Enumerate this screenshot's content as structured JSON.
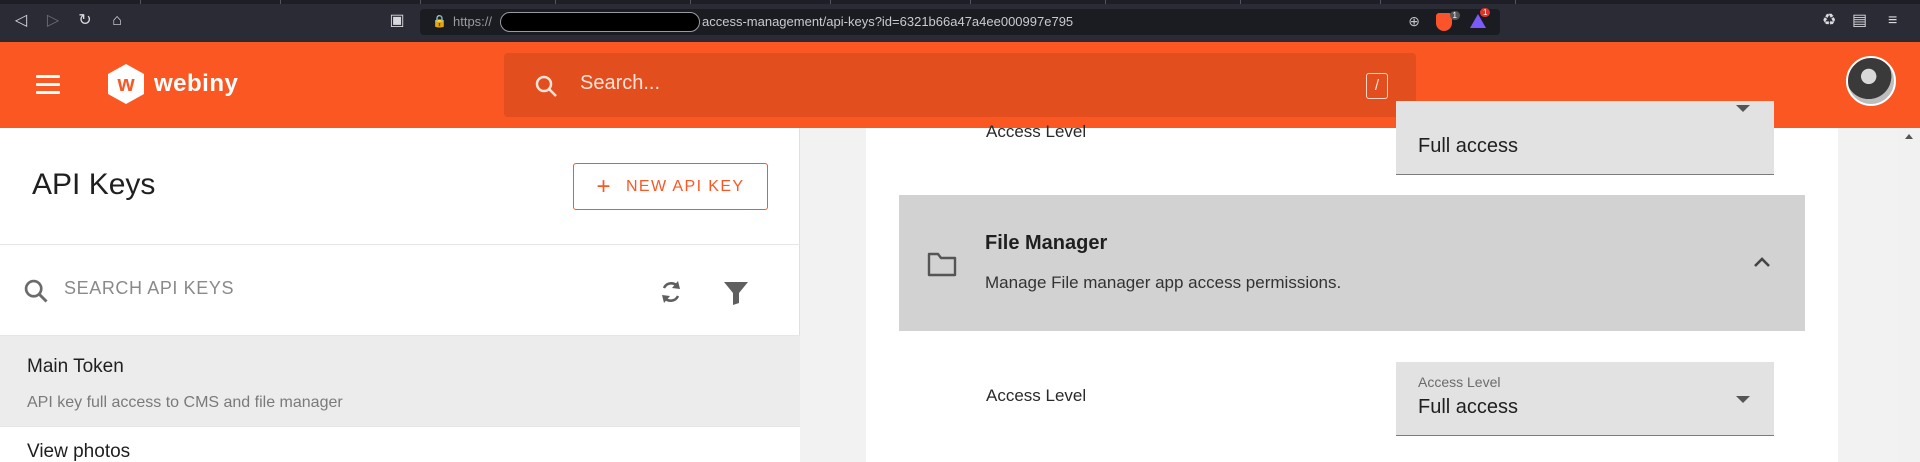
{
  "browser": {
    "url_protocol": "https://",
    "url_path": "access-management/api-keys?id=6321b66a47a4ee000997e795",
    "shield_count": "1",
    "rewards_count": "1"
  },
  "header": {
    "menu_icon": "hamburger-menu-icon",
    "logo_mark": "w",
    "logo_text": "webiny",
    "search_placeholder": "Search...",
    "search_shortcut": "/"
  },
  "left": {
    "title": "API Keys",
    "new_button_label": "NEW API KEY",
    "search_placeholder": "SEARCH API KEYS",
    "items": [
      {
        "name": "Main Token",
        "description": "API key full access to CMS and file manager",
        "selected": true
      },
      {
        "name": "View photos",
        "description": "",
        "selected": false
      }
    ]
  },
  "right": {
    "top_row": {
      "label": "Access Level",
      "select_value": "Full access"
    },
    "section": {
      "title": "File Manager",
      "description": "Manage File manager app access permissions."
    },
    "bottom_row": {
      "label": "Access Level",
      "select_label": "Access Level",
      "select_value": "Full access"
    }
  },
  "colors": {
    "brand": "#fa5723",
    "section_bg": "#d2d2d2",
    "select_bg": "#e2e2e2"
  }
}
